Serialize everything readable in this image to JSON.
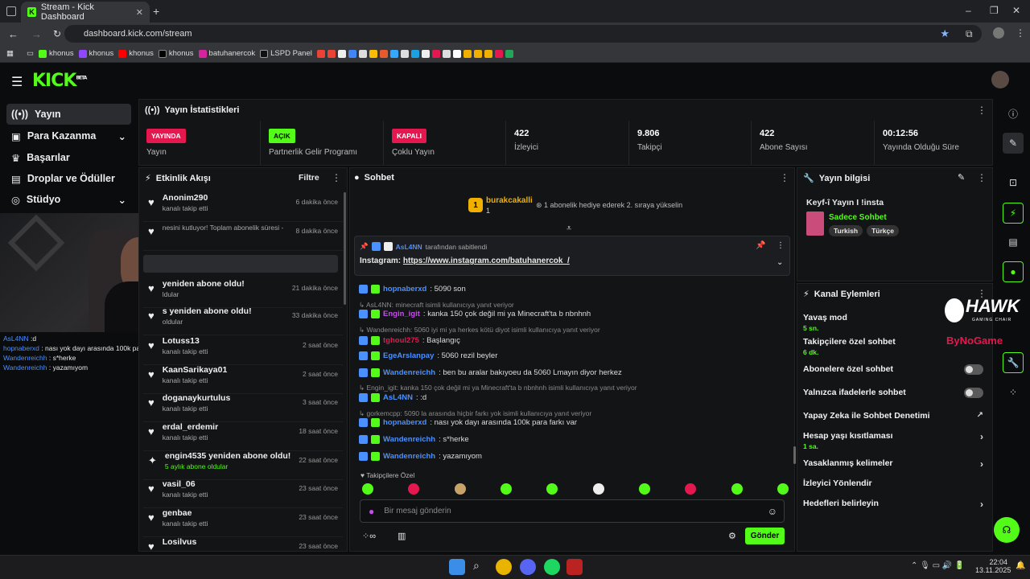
{
  "browser": {
    "tab_title": "Stream - Kick Dashboard",
    "url": "dashboard.kick.com/stream",
    "bookmarks": [
      "khonus",
      "khonus",
      "khonus",
      "khonus",
      "batuhanercok",
      "LSPD Panel"
    ]
  },
  "sidebar": {
    "items": [
      {
        "label": "Yayın",
        "icon": "broadcast-icon"
      },
      {
        "label": "Para Kazanma",
        "icon": "money-icon",
        "chev": "⌄"
      },
      {
        "label": "Başarılar",
        "icon": "trophy-icon"
      },
      {
        "label": "Droplar ve Ödüller",
        "icon": "gift-icon"
      },
      {
        "label": "Stüdyo",
        "icon": "studio-icon",
        "chev": "⌄"
      }
    ]
  },
  "stats": {
    "title": "Yayın İstatistikleri",
    "items": [
      {
        "badge": "YAYINDA",
        "badge_color": "#e5174f",
        "label": "Yayın"
      },
      {
        "badge": "AÇIK",
        "badge_color": "#53fc18",
        "label": "Partnerlik Gelir Programı"
      },
      {
        "badge": "KAPALI",
        "badge_color": "#e5174f",
        "label": "Çoklu Yayın"
      },
      {
        "value": "422",
        "label": "İzleyici"
      },
      {
        "value": "9.806",
        "label": "Takipçi"
      },
      {
        "value": "422",
        "label": "Abone Sayısı"
      },
      {
        "value": "00:12:56",
        "label": "Yayında Olduğu Süre"
      }
    ]
  },
  "activity": {
    "title": "Etkinlik Akışı",
    "filter": "Filtre",
    "items": [
      {
        "name": "Anonim290",
        "sub": "kanalı takip etti",
        "time": "6 dakika önce"
      },
      {
        "name": "",
        "sub": "nesini kutluyor! Toplam abonelik süresi -",
        "time": "8 dakika önce"
      },
      {
        "name": "yeniden abone oldu!",
        "sub": "ldular",
        "time": "21 dakika önce"
      },
      {
        "name": "s yeniden abone oldu!",
        "sub": "oldular",
        "time": "33 dakika önce"
      },
      {
        "name": "Lotuss13",
        "sub": "kanalı takip etti",
        "time": "2 saat önce"
      },
      {
        "name": "KaanSarikaya01",
        "sub": "kanalı takip etti",
        "time": "2 saat önce"
      },
      {
        "name": "doganaykurtulus",
        "sub": "kanalı takip etti",
        "time": "3 saat önce"
      },
      {
        "name": "erdal_erdemir",
        "sub": "kanalı takip etti",
        "time": "18 saat önce"
      },
      {
        "name": "engin4535 yeniden abone oldu!",
        "sub": "5 aylık abone oldular",
        "time": "22 saat önce"
      },
      {
        "name": "vasil_06",
        "sub": "kanalı takip etti",
        "time": "23 saat önce"
      },
      {
        "name": "genbae",
        "sub": "kanalı takip etti",
        "time": "23 saat önce"
      },
      {
        "name": "Losilvus",
        "sub": "",
        "time": "23 saat önce"
      }
    ]
  },
  "overlay_chat": [
    {
      "user": "AsL4NN",
      "text": ":d"
    },
    {
      "user": "hopnaberxd",
      "text": "nası yok dayı arasında 100k para farkı var"
    },
    {
      "user": "Wandenreichh",
      "text": "s*herke"
    },
    {
      "user": "Wandenreichh",
      "text": "yazamıyom"
    }
  ],
  "chat": {
    "title": "Sohbet",
    "top_user": "burakcakalli",
    "top_count": "1",
    "gift_text": "1 abonelik hediye ederek 2. sıraya yükselin",
    "pinned_by": "AsL4NN",
    "pinned_suffix": "tarafından sabitlendi",
    "pinned_label": "Instagram:",
    "pinned_link": "https://www.instagram.com/batuhanercok_/",
    "messages": [
      {
        "user": "hopnaberxd",
        "color": "#4a90ff",
        "text": ": 5090 son"
      },
      {
        "reply": "AsL4NN: minecraft isimli kullanıcıya yanıt veriyor"
      },
      {
        "user": "Engin_igit",
        "color": "#c94cf0",
        "text": ": kanka 150 çok değil mi ya Minecraft'ta b nbnhnh"
      },
      {
        "reply": "Wandenreichh: 5060 iyi mi ya herkes kötü diyot isimli kullanıcıya yanıt veriyor"
      },
      {
        "user": "tghoul275",
        "color": "#e5174f",
        "text": ": Başlangıç"
      },
      {
        "user": "EgeArslanpay",
        "color": "#4a90ff",
        "text": ": 5060 rezil beyler"
      },
      {
        "user": "Wandenreichh",
        "color": "#4a90ff",
        "text": ": ben bu aralar bakıyoeu da 5060 Lmayın diyor herkez"
      },
      {
        "reply": "Engin_igit: kanka 150 çok değil mi ya Minecraft'ta b nbnhnh isimli kullanıcıya yanıt veriyor"
      },
      {
        "user": "AsL4NN",
        "color": "#4a90ff",
        "text": ": :d"
      },
      {
        "reply": "gorkemcpp: 5090 la arasında hiçbir farkı yok isimli kullanıcıya yanıt veriyor"
      },
      {
        "user": "hopnaberxd",
        "color": "#4a90ff",
        "text": ": nası yok dayı arasında 100k para farkı var"
      },
      {
        "user": "Wandenreichh",
        "color": "#4a90ff",
        "text": ": s*herke"
      },
      {
        "user": "Wandenreichh",
        "color": "#4a90ff",
        "text": ": yazamıyom"
      }
    ],
    "followers_only": "Takipçilere Özel",
    "placeholder": "Bir mesaj gönderin",
    "send": "Gönder"
  },
  "stream_info": {
    "title": "Yayın bilgisi",
    "stream_title": "Keyf-î Yayın I !insta",
    "category": "Sadece Sohbet",
    "tags": [
      "Turkish",
      "Türkçe"
    ]
  },
  "channel_actions": {
    "title": "Kanal Eylemleri",
    "items": [
      {
        "label": "Yavaş mod",
        "sub": "5 sn."
      },
      {
        "label": "Takipçilere özel sohbet",
        "sub": "6 dk."
      },
      {
        "label": "Abonelere özel sohbet",
        "toggle": true
      },
      {
        "label": "Yalnızca ifadelerle sohbet",
        "toggle": true
      },
      {
        "label": "Yapay Zeka ile Sohbet Denetimi",
        "ext": "↗"
      },
      {
        "label": "Hesap yaşı kısıtlaması",
        "sub": "1 sa.",
        "chev": "›"
      },
      {
        "label": "Yasaklanmış kelimeler",
        "chev": "›"
      },
      {
        "label": "İzleyici Yönlendir"
      },
      {
        "label": "Hedefleri belirleyin",
        "chev": "›"
      }
    ]
  },
  "watermark": {
    "brand": "HAWK",
    "brand_sub": "GAMING CHAIR",
    "sponsor": "ByNoGame"
  },
  "clock": {
    "time": "22:04",
    "date": "13.11.2025"
  },
  "colors": {
    "accent": "#53fc18",
    "live": "#e5174f"
  }
}
